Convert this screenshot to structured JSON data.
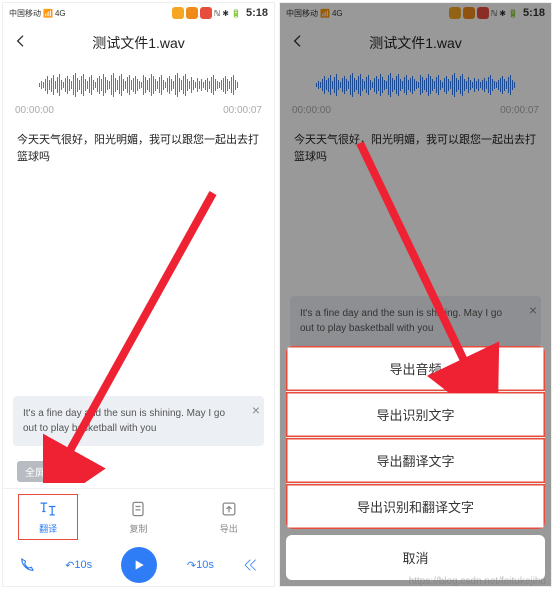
{
  "statusbar": {
    "carrier": "中国移动",
    "time": "5:18",
    "signal_text": "4G"
  },
  "header": {
    "title": "测试文件1.wav"
  },
  "time": {
    "start": "00:00:00",
    "end": "00:00:07"
  },
  "transcript": {
    "text": "今天天气很好，阳光明媚，我可以跟您一起出去打篮球吗"
  },
  "translation": {
    "text": "It's a fine day and the sun is shining. May I go out to play basketball with you"
  },
  "buttons": {
    "fullscreen": "全屏"
  },
  "toolbar": {
    "translate": "翻译",
    "copy": "复制",
    "export": "导出"
  },
  "playbar": {
    "rewind": "10s",
    "forward": "10s"
  },
  "sheet": {
    "items": [
      "导出音频",
      "导出识别文字",
      "导出翻译文字",
      "导出识别和翻译文字"
    ],
    "cancel": "取消"
  },
  "watermark": "https://blog.csdn.net/feitukejihu"
}
